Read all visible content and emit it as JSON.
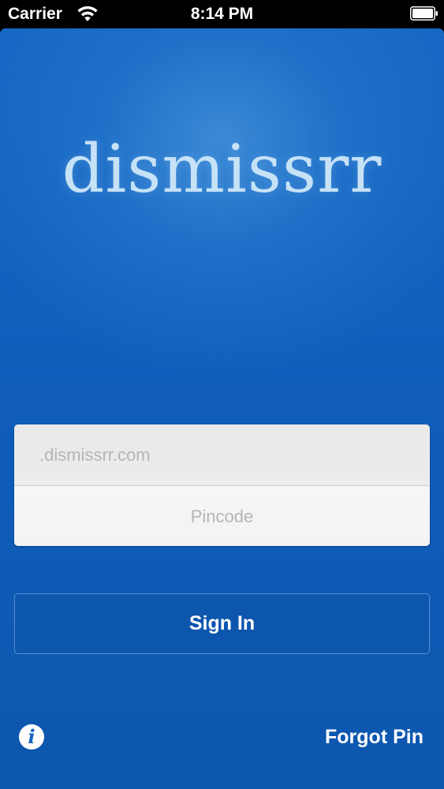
{
  "status_bar": {
    "carrier": "Carrier",
    "time": "8:14 PM",
    "icons": {
      "wifi": "wifi-icon",
      "battery": "battery-icon"
    }
  },
  "app": {
    "logo_text": "dismissrr"
  },
  "login_form": {
    "domain_field": {
      "value": "",
      "placeholder": ".dismissrr.com"
    },
    "pin_field": {
      "value": "",
      "placeholder": "Pincode"
    },
    "sign_in_label": "Sign In"
  },
  "footer": {
    "info_icon": "info-icon",
    "info_glyph": "i",
    "forgot_pin_label": "Forgot Pin"
  },
  "colors": {
    "background_blue": "#1566c3",
    "logo_color": "#c6e2f7",
    "field_background": "#f1f1f1",
    "placeholder_color": "#b5b5b5",
    "button_text": "#ffffff"
  }
}
